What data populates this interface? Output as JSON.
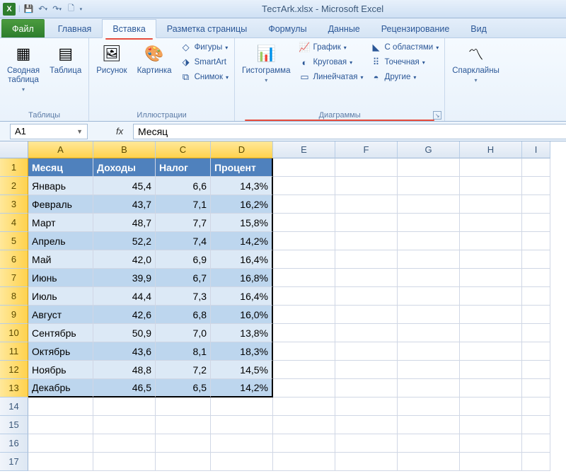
{
  "app": {
    "title": "ТестArk.xlsx - Microsoft Excel"
  },
  "qat": {
    "save": "save-icon",
    "undo": "undo-icon",
    "redo": "redo-icon",
    "new": "new-icon"
  },
  "tabs": {
    "file": "Файл",
    "items": [
      "Главная",
      "Вставка",
      "Разметка страницы",
      "Формулы",
      "Данные",
      "Рецензирование",
      "Вид"
    ],
    "active_index": 1
  },
  "ribbon": {
    "groups": {
      "tables": {
        "label": "Таблицы",
        "pivot": "Сводная\nтаблица",
        "table": "Таблица"
      },
      "illustrations": {
        "label": "Иллюстрации",
        "picture": "Рисунок",
        "clipart": "Картинка",
        "shapes": "Фигуры",
        "smartart": "SmartArt",
        "screenshot": "Снимок"
      },
      "charts": {
        "label": "Диаграммы",
        "histogram": "Гистограмма",
        "line": "График",
        "pie": "Круговая",
        "bar": "Линейчатая",
        "area": "С областями",
        "scatter": "Точечная",
        "other": "Другие"
      },
      "sparklines": {
        "label": "",
        "spark": "Спарклайны"
      }
    }
  },
  "formula_bar": {
    "name_box": "A1",
    "fx": "fx",
    "formula": "Месяц"
  },
  "grid": {
    "col_letters": [
      "A",
      "B",
      "C",
      "D",
      "E",
      "F",
      "G",
      "H",
      "I"
    ],
    "selected_cols": 4,
    "selected_rows": 13,
    "headers": [
      "Месяц",
      "Доходы",
      "Налог",
      "Процент"
    ],
    "rows": [
      {
        "m": "Январь",
        "d": "45,4",
        "n": "6,6",
        "p": "14,3%"
      },
      {
        "m": "Февраль",
        "d": "43,7",
        "n": "7,1",
        "p": "16,2%"
      },
      {
        "m": "Март",
        "d": "48,7",
        "n": "7,7",
        "p": "15,8%"
      },
      {
        "m": "Апрель",
        "d": "52,2",
        "n": "7,4",
        "p": "14,2%"
      },
      {
        "m": "Май",
        "d": "42,0",
        "n": "6,9",
        "p": "16,4%"
      },
      {
        "m": "Июнь",
        "d": "39,9",
        "n": "6,7",
        "p": "16,8%"
      },
      {
        "m": "Июль",
        "d": "44,4",
        "n": "7,3",
        "p": "16,4%"
      },
      {
        "m": "Август",
        "d": "42,6",
        "n": "6,8",
        "p": "16,0%"
      },
      {
        "m": "Сентябрь",
        "d": "50,9",
        "n": "7,0",
        "p": "13,8%"
      },
      {
        "m": "Октябрь",
        "d": "43,6",
        "n": "8,1",
        "p": "18,3%"
      },
      {
        "m": "Ноябрь",
        "d": "48,8",
        "n": "7,2",
        "p": "14,5%"
      },
      {
        "m": "Декабрь",
        "d": "46,5",
        "n": "6,5",
        "p": "14,2%"
      }
    ],
    "blank_rows": 4
  }
}
